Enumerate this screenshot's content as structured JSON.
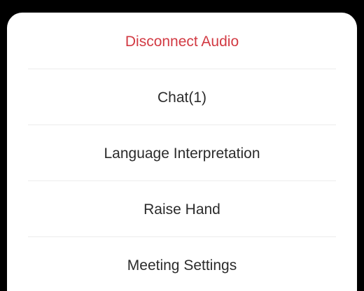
{
  "menu": {
    "items": [
      {
        "label": "Disconnect Audio",
        "style": "danger"
      },
      {
        "label": "Chat(1)",
        "style": "normal"
      },
      {
        "label": "Language Interpretation",
        "style": "normal"
      },
      {
        "label": "Raise Hand",
        "style": "normal"
      },
      {
        "label": "Meeting Settings",
        "style": "normal"
      }
    ]
  },
  "colors": {
    "danger_text": "#d23a43",
    "normal_text": "#2b2b2b",
    "sheet_background": "#ffffff",
    "backdrop": "#000000",
    "divider": "#ececec"
  }
}
